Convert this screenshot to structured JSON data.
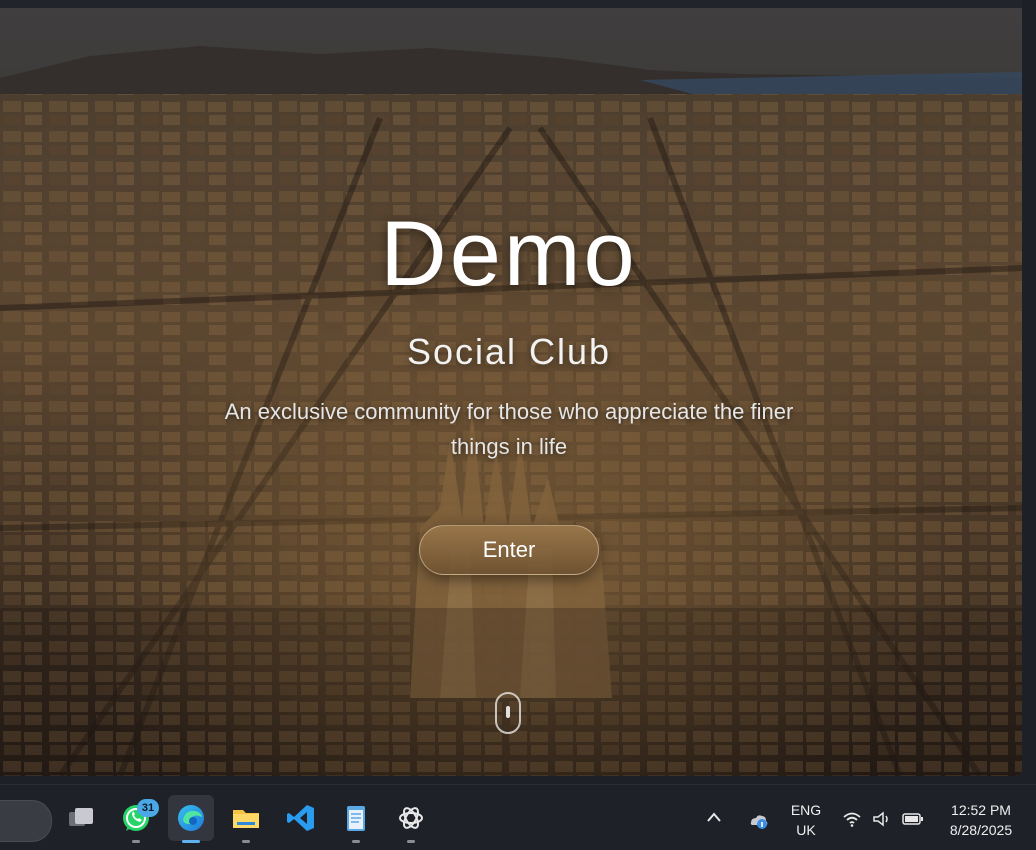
{
  "hero": {
    "title": "Demo",
    "subtitle": "Social Club",
    "tagline": "An exclusive community for those who appreciate the finer things in life",
    "enter_label": "Enter"
  },
  "taskbar": {
    "apps": [
      {
        "name": "Task View"
      },
      {
        "name": "WhatsApp",
        "badge": "31"
      },
      {
        "name": "Microsoft Edge",
        "active": true
      },
      {
        "name": "File Explorer"
      },
      {
        "name": "Visual Studio Code"
      },
      {
        "name": "Notepad"
      },
      {
        "name": "ChatGPT"
      }
    ],
    "tray": {
      "language_line1": "ENG",
      "language_line2": "UK",
      "time": "12:52 PM",
      "date": "8/28/2025"
    }
  },
  "colors": {
    "accent": "#5fb2f0",
    "button_gold": "#8c6a42",
    "taskbar_bg": "#1f2128"
  }
}
